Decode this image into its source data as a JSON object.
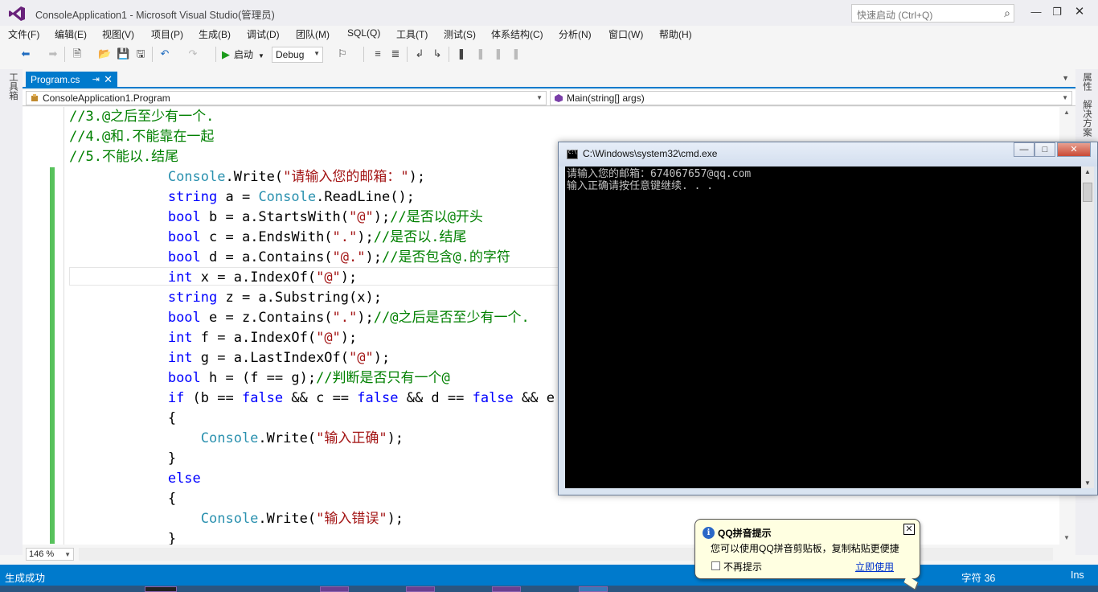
{
  "window": {
    "title": "ConsoleApplication1 - Microsoft Visual Studio(管理员)",
    "quick_launch_placeholder": "快速启动 (Ctrl+Q)"
  },
  "menu": [
    "文件(F)",
    "编辑(E)",
    "视图(V)",
    "项目(P)",
    "生成(B)",
    "调试(D)",
    "团队(M)",
    "SQL(Q)",
    "工具(T)",
    "测试(S)",
    "体系结构(C)",
    "分析(N)",
    "窗口(W)",
    "帮助(H)"
  ],
  "toolbar": {
    "start_label": "启动",
    "configuration": "Debug"
  },
  "side_tabs": {
    "toolbox": "工具箱",
    "properties": "属性",
    "solution_explorer": "解决方案"
  },
  "document": {
    "tab_label": "Program.cs",
    "nav_class": "ConsoleApplication1.Program",
    "nav_member": "Main(string[] args)"
  },
  "code_lines": [
    [
      [
        "cm",
        "//3.@之后至少有一个."
      ]
    ],
    [
      [
        "cm",
        "//4.@和.不能靠在一起"
      ]
    ],
    [
      [
        "cm",
        "//5.不能以.结尾"
      ]
    ],
    [
      [
        "pl",
        "            "
      ],
      [
        "ty",
        "Console"
      ],
      [
        "pl",
        ".Write("
      ],
      [
        "st",
        "\"请输入您的邮箱：\""
      ],
      [
        "pl",
        ");"
      ]
    ],
    [
      [
        "pl",
        "            "
      ],
      [
        "kw",
        "string"
      ],
      [
        "pl",
        " a = "
      ],
      [
        "ty",
        "Console"
      ],
      [
        "pl",
        ".ReadLine();"
      ]
    ],
    [
      [
        "pl",
        "            "
      ],
      [
        "kw",
        "bool"
      ],
      [
        "pl",
        " b = a.StartsWith("
      ],
      [
        "st",
        "\"@\""
      ],
      [
        "pl",
        ");"
      ],
      [
        "cm",
        "//是否以@开头"
      ]
    ],
    [
      [
        "pl",
        "            "
      ],
      [
        "kw",
        "bool"
      ],
      [
        "pl",
        " c = a.EndsWith("
      ],
      [
        "st",
        "\".\""
      ],
      [
        "pl",
        ");"
      ],
      [
        "cm",
        "//是否以.结尾"
      ]
    ],
    [
      [
        "pl",
        "            "
      ],
      [
        "kw",
        "bool"
      ],
      [
        "pl",
        " d = a.Contains("
      ],
      [
        "st",
        "\"@.\""
      ],
      [
        "pl",
        ");"
      ],
      [
        "cm",
        "//是否包含@.的字符"
      ]
    ],
    [
      [
        "pl",
        "            "
      ],
      [
        "kw",
        "int"
      ],
      [
        "pl",
        " x = a.IndexOf("
      ],
      [
        "st",
        "\"@\""
      ],
      [
        "pl",
        ");"
      ]
    ],
    [
      [
        "pl",
        "            "
      ],
      [
        "kw",
        "string"
      ],
      [
        "pl",
        " z = a.Substring(x);"
      ]
    ],
    [
      [
        "pl",
        "            "
      ],
      [
        "kw",
        "bool"
      ],
      [
        "pl",
        " e = z.Contains("
      ],
      [
        "st",
        "\".\""
      ],
      [
        "pl",
        ");"
      ],
      [
        "cm",
        "//@之后是否至少有一个."
      ]
    ],
    [
      [
        "pl",
        "            "
      ],
      [
        "kw",
        "int"
      ],
      [
        "pl",
        " f = a.IndexOf("
      ],
      [
        "st",
        "\"@\""
      ],
      [
        "pl",
        ");"
      ]
    ],
    [
      [
        "pl",
        "            "
      ],
      [
        "kw",
        "int"
      ],
      [
        "pl",
        " g = a.LastIndexOf("
      ],
      [
        "st",
        "\"@\""
      ],
      [
        "pl",
        ");"
      ]
    ],
    [
      [
        "pl",
        "            "
      ],
      [
        "kw",
        "bool"
      ],
      [
        "pl",
        " h = (f == g);"
      ],
      [
        "cm",
        "//判断是否只有一个@"
      ]
    ],
    [
      [
        "pl",
        "            "
      ],
      [
        "kw",
        "if"
      ],
      [
        "pl",
        " (b == "
      ],
      [
        "kw",
        "false"
      ],
      [
        "pl",
        " && c == "
      ],
      [
        "kw",
        "false"
      ],
      [
        "pl",
        " && d == "
      ],
      [
        "kw",
        "false"
      ],
      [
        "pl",
        " && e =="
      ]
    ],
    [
      [
        "pl",
        "            {"
      ]
    ],
    [
      [
        "pl",
        "                "
      ],
      [
        "ty",
        "Console"
      ],
      [
        "pl",
        ".Write("
      ],
      [
        "st",
        "\"输入正确\""
      ],
      [
        "pl",
        ");"
      ]
    ],
    [
      [
        "pl",
        "            }"
      ]
    ],
    [
      [
        "pl",
        "            "
      ],
      [
        "kw",
        "else"
      ]
    ],
    [
      [
        "pl",
        "            {"
      ]
    ],
    [
      [
        "pl",
        "                "
      ],
      [
        "ty",
        "Console"
      ],
      [
        "pl",
        ".Write("
      ],
      [
        "st",
        "\"输入错误\""
      ],
      [
        "pl",
        ");"
      ]
    ],
    [
      [
        "pl",
        "            }"
      ]
    ]
  ],
  "zoom": "146 %",
  "cmd": {
    "title": "C:\\Windows\\system32\\cmd.exe",
    "lines": [
      "请输入您的邮箱：674067657@qq.com",
      "输入正确请按任意键继续. . ."
    ]
  },
  "status": {
    "text": "生成成功",
    "column": "字符 36",
    "mode": "Ins"
  },
  "qq_tip": {
    "title": "QQ拼音提示",
    "body": "您可以使用QQ拼音剪贴板，复制粘贴更便捷",
    "dont_show": "不再提示",
    "link": "立即使用"
  },
  "colors": {
    "accent": "#007acc",
    "comment": "#008000",
    "keyword": "#0000ff",
    "type": "#2b91af",
    "string": "#a31515",
    "change_bar": "#57c25c"
  }
}
